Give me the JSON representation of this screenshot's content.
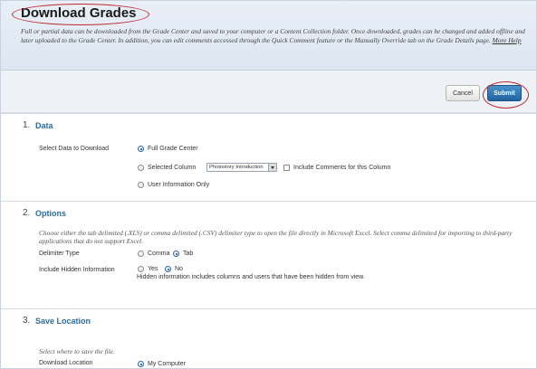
{
  "header": {
    "title": "Download Grades",
    "description": "Full or partial data can be downloaded from the Grade Center and saved to your computer or a Content Collection folder. Once downloaded, grades can be changed and added offline and later uploaded to the Grade Center. In addition, you can edit comments accessed through the Quick Comment feature or the Manually Override tab on the Grade Details page.",
    "more_help": "More Help"
  },
  "toolbar": {
    "cancel_label": "Cancel",
    "submit_label": "Submit"
  },
  "sections": [
    {
      "number": "1.",
      "title": "Data",
      "select_label": "Select Data to Download",
      "options": {
        "full": "Full Grade Center",
        "selected_column": "Selected Column",
        "column_value": "Photostory Introduction",
        "include_comments": "Include Comments for this Column",
        "user_info": "User Information Only"
      }
    },
    {
      "number": "2.",
      "title": "Options",
      "description": "Choose either the tab delimited (.XLS) or comma delimited (.CSV) delimiter type to open the file directly in Microsoft Excel. Select comma delimited for importing to third-party applications that do not support Excel.",
      "delimiter_label": "Delimiter Type",
      "comma": "Comma",
      "tab": "Tab",
      "hidden_label": "Include Hidden Information",
      "yes": "Yes",
      "no": "No",
      "hidden_note": "Hidden information includes columns and users that have been hidden from view."
    },
    {
      "number": "3.",
      "title": "Save Location",
      "description": "Select where to save the file.",
      "location_label": "Download Location",
      "my_computer": "My Computer"
    }
  ],
  "colors": {
    "accent": "#2b6ca3",
    "annotation": "#c0282d",
    "submit": "#21639f"
  }
}
